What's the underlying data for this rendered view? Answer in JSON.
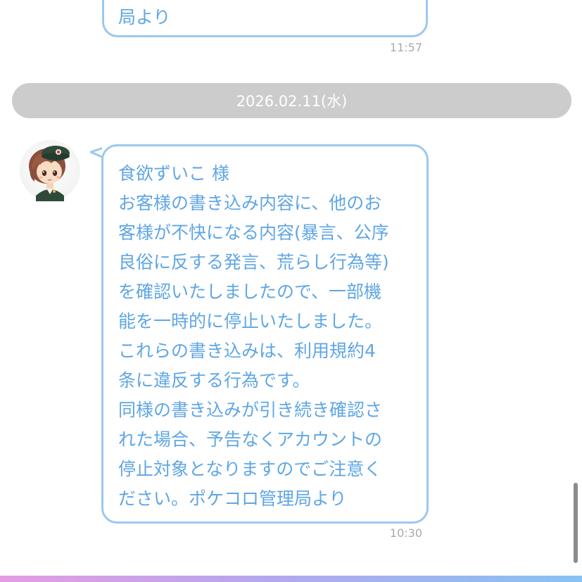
{
  "prev_message": {
    "last_line": "局より",
    "time": "11:57"
  },
  "date_separator": "2026.02.11(水)",
  "message": {
    "lines": [
      "食欲ずいこ 様",
      "お客様の書き込み内容に、他のお",
      "客様が不快になる内容(暴言、公序",
      "良俗に反する発言、荒らし行為等)",
      "を確認いたしましたので、一部機",
      "能を一時的に停止いたしました。",
      "これらの書き込みは、利用規約4",
      "条に違反する行為です。",
      "同様の書き込みが引き続き確認さ",
      "れた場合、予告なくアカウントの",
      "停止対象となりますのでご注意く",
      "ださい。ポケコロ管理局より"
    ],
    "time": "10:30"
  },
  "colors": {
    "bubble_border": "#9cc8ef",
    "bubble_text": "#5fa6e4",
    "date_bar": "#cccccc",
    "timestamp": "#aaaaaa"
  },
  "icons": {
    "avatar": "admin-character-avatar"
  }
}
